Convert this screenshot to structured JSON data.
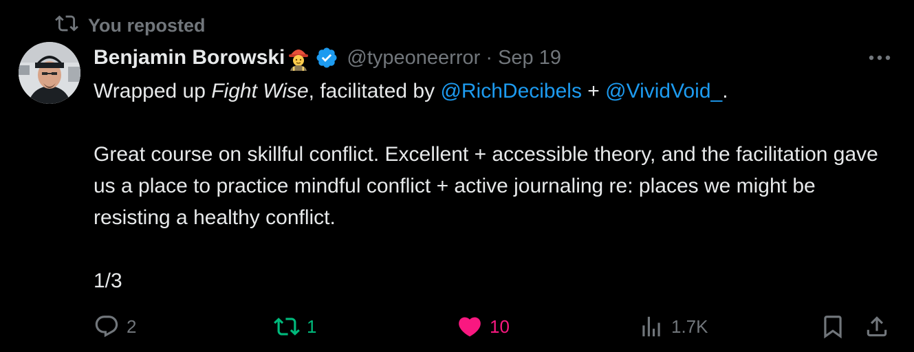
{
  "banner": {
    "label": "You reposted",
    "icon": "repost-icon"
  },
  "author": {
    "display_name": "Benjamin Borowski",
    "emoji": "construction-worker-emoji",
    "verified": true,
    "handle": "@typeoneerror",
    "separator": "·",
    "date": "Sep 19"
  },
  "tweet": {
    "line1": {
      "prefix": "Wrapped up ",
      "italic": "Fight Wise",
      "middle": ", facilitated by ",
      "mention1": "@RichDecibels",
      "joiner": " + ",
      "mention2": "@VividVoid_",
      "suffix": "."
    },
    "paragraph2": "Great course on skillful conflict. Excellent + accessible theory, and the facilitation gave us a place to practice mindful conflict + active journaling re: places we might be resisting a healthy conflict.",
    "thread_marker": "1/3"
  },
  "actions": {
    "reply_count": "2",
    "repost_count": "1",
    "like_count": "10",
    "view_count": "1.7K"
  },
  "colors": {
    "background": "#000000",
    "text": "#e7e9ea",
    "muted": "#71767b",
    "link": "#1d9bf0",
    "repost_active": "#00ba7c",
    "like_active": "#f91880",
    "verified": "#1d9bf0"
  }
}
